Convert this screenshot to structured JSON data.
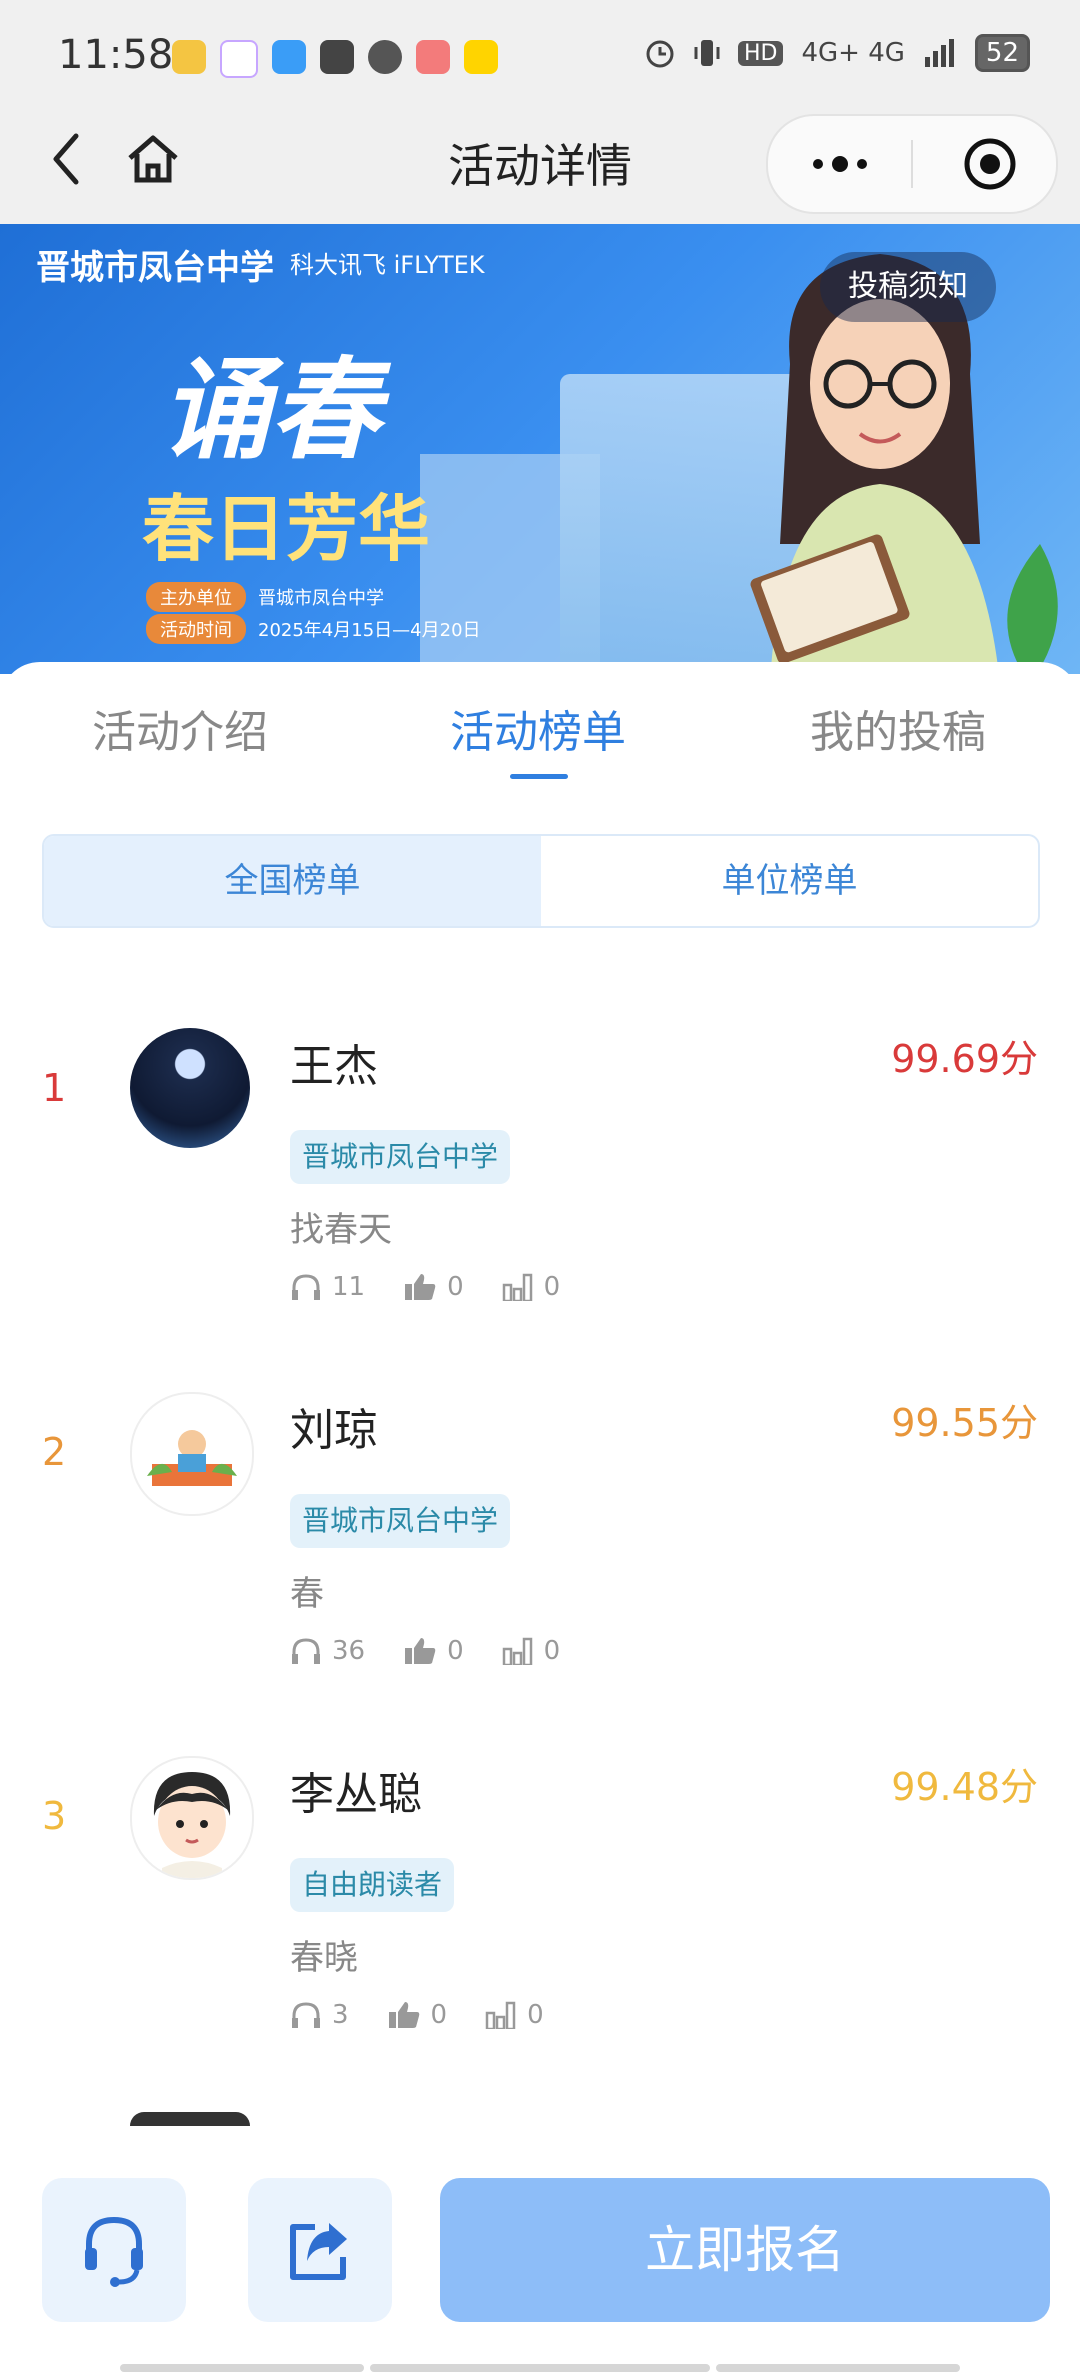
{
  "status_bar": {
    "time": "11:58",
    "network": "4G+ 4G",
    "battery": "52"
  },
  "nav": {
    "title": "活动详情"
  },
  "banner": {
    "school": "晋城市凤台中学",
    "brand": "科大讯飞 iFLYTEK",
    "headline": "诵春",
    "subheadline": "春日芳华",
    "host_label": "主办单位",
    "host_value": "晋城市凤台中学",
    "time_label": "活动时间",
    "time_value": "2025年4月15日—4月20日",
    "notice_button": "投稿须知"
  },
  "tabs": [
    {
      "label": "活动介绍",
      "active": false
    },
    {
      "label": "活动榜单",
      "active": true
    },
    {
      "label": "我的投稿",
      "active": false
    }
  ],
  "segments": [
    {
      "label": "全国榜单",
      "active": true
    },
    {
      "label": "单位榜单",
      "active": false
    }
  ],
  "ranking": [
    {
      "rank": "1",
      "name": "王杰",
      "score": "99.69分",
      "org": "晋城市凤台中学",
      "work": "找春天",
      "listens": "11",
      "likes": "0",
      "votes": "0",
      "color": "#d93a3a"
    },
    {
      "rank": "2",
      "name": "刘琼",
      "score": "99.55分",
      "org": "晋城市凤台中学",
      "work": "春",
      "listens": "36",
      "likes": "0",
      "votes": "0",
      "color": "#e8963a"
    },
    {
      "rank": "3",
      "name": "李丛聪",
      "score": "99.48分",
      "org": "自由朗读者",
      "work": "春晓",
      "listens": "3",
      "likes": "0",
      "votes": "0",
      "color": "#f0b93e"
    }
  ],
  "bottom": {
    "signup_label": "立即报名"
  }
}
